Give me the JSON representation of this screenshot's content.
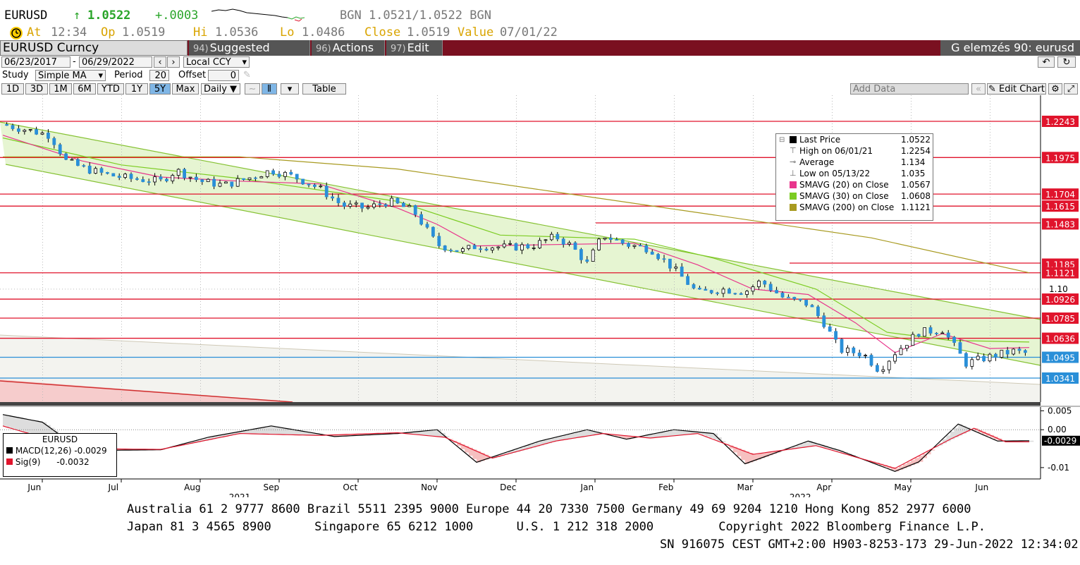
{
  "ticker": {
    "symbol": "EURUSD",
    "arrow": "↑",
    "last": "1.0522",
    "change": "+.0003",
    "bid_ask": "BGN 1.0521/1.0522 BGN",
    "at_label": "At",
    "at_value": "12:34",
    "op_label": "Op",
    "op_value": "1.0519",
    "hi_label": "Hi",
    "hi_value": "1.0536",
    "lo_label": "Lo",
    "lo_value": "1.0486",
    "close_label": "Close",
    "close_value": "1.0519",
    "value_label": "Value",
    "value_value": "07/01/22"
  },
  "toolbar": {
    "security": "EURUSD Curncy",
    "tabs": [
      {
        "num": "94)",
        "label": "Suggested Charts"
      },
      {
        "num": "96)",
        "label": "Actions ▾"
      },
      {
        "num": "97)",
        "label": "Edit ▾"
      }
    ],
    "right_title": "G elemzés 90: eurusd"
  },
  "controls": {
    "date_from": "06/23/2017",
    "date_to": "06/29/2022",
    "currency": "Local CCY",
    "study_label": "Study",
    "study_value": "Simple MA",
    "period_label": "Period",
    "period_value": "20",
    "offset_label": "Offset",
    "offset_value": "0",
    "ranges": [
      "1D",
      "3D",
      "1M",
      "6M",
      "YTD",
      "1Y",
      "5Y",
      "Max"
    ],
    "selected_range": "5Y",
    "frequency": "Daily ▼",
    "table_label": "Table",
    "add_data": "Add Data",
    "edit_chart": "Edit Chart"
  },
  "legend": {
    "rows": [
      {
        "label": "Last Price",
        "value": "1.0522",
        "color": "#000000"
      },
      {
        "label": "High on 06/01/21",
        "value": "1.2254",
        "color": ""
      },
      {
        "label": "Average",
        "value": "1.134",
        "color": ""
      },
      {
        "label": "Low on 05/13/22",
        "value": "1.035",
        "color": ""
      },
      {
        "label": "SMAVG (20)  on Close",
        "value": "1.0567",
        "color": "#e8358c"
      },
      {
        "label": "SMAVG (30)  on Close",
        "value": "1.0608",
        "color": "#7ccc22"
      },
      {
        "label": "SMAVG (200)  on Close",
        "value": "1.1121",
        "color": "#a89a20"
      }
    ]
  },
  "macd_legend": {
    "title": "EURUSD",
    "macd_label": "MACD(12,26)",
    "macd_value": "-0.0029",
    "sig_label": "Sig(9)",
    "sig_value": "-0.0032"
  },
  "chart_data": {
    "type": "candlestick",
    "price_axis": {
      "min": 1.03,
      "max": 1.245,
      "ticks": [
        "1.10"
      ]
    },
    "level_labels": [
      {
        "value": 1.2243,
        "label": "1.2243",
        "color": "#e0142c"
      },
      {
        "value": 1.1975,
        "label": "1.1975",
        "color": "#e0142c"
      },
      {
        "value": 1.1704,
        "label": "1.1704",
        "color": "#e0142c"
      },
      {
        "value": 1.1615,
        "label": "1.1615",
        "color": "#e0142c"
      },
      {
        "value": 1.1483,
        "label": "1.1483",
        "color": "#e0142c"
      },
      {
        "value": 1.1185,
        "label": "1.1185",
        "color": "#e0142c"
      },
      {
        "value": 1.1121,
        "label": "1.1121",
        "color": "#e0142c"
      },
      {
        "value": 1.0926,
        "label": "1.0926",
        "color": "#e0142c"
      },
      {
        "value": 1.0785,
        "label": "1.0785",
        "color": "#e0142c"
      },
      {
        "value": 1.0636,
        "label": "1.0636",
        "color": "#e0142c"
      },
      {
        "value": 1.0495,
        "label": "1.0495",
        "color": "#2a8fd8"
      },
      {
        "value": 1.0341,
        "label": "1.0341",
        "color": "#2a8fd8"
      }
    ],
    "months": [
      "Jun",
      "Jul",
      "Aug",
      "Sep",
      "Oct",
      "Nov",
      "Dec",
      "Jan",
      "Feb",
      "Mar",
      "Apr",
      "May",
      "Jun"
    ],
    "years": [
      "2021",
      "2022"
    ],
    "series": {
      "close": [
        {
          "m": 0.0,
          "v": 1.222
        },
        {
          "m": 0.3,
          "v": 1.218
        },
        {
          "m": 0.6,
          "v": 1.214
        },
        {
          "m": 0.8,
          "v": 1.195
        },
        {
          "m": 1.0,
          "v": 1.19
        },
        {
          "m": 1.3,
          "v": 1.185
        },
        {
          "m": 1.6,
          "v": 1.182
        },
        {
          "m": 2.0,
          "v": 1.18
        },
        {
          "m": 2.2,
          "v": 1.188
        },
        {
          "m": 2.5,
          "v": 1.18
        },
        {
          "m": 2.8,
          "v": 1.177
        },
        {
          "m": 3.1,
          "v": 1.182
        },
        {
          "m": 3.4,
          "v": 1.188
        },
        {
          "m": 3.7,
          "v": 1.183
        },
        {
          "m": 4.0,
          "v": 1.175
        },
        {
          "m": 4.3,
          "v": 1.162
        },
        {
          "m": 4.6,
          "v": 1.16
        },
        {
          "m": 4.9,
          "v": 1.165
        },
        {
          "m": 5.2,
          "v": 1.158
        },
        {
          "m": 5.5,
          "v": 1.133
        },
        {
          "m": 5.8,
          "v": 1.128
        },
        {
          "m": 6.0,
          "v": 1.132
        },
        {
          "m": 6.4,
          "v": 1.131
        },
        {
          "m": 6.7,
          "v": 1.132
        },
        {
          "m": 7.0,
          "v": 1.139
        },
        {
          "m": 7.2,
          "v": 1.132
        },
        {
          "m": 7.4,
          "v": 1.119
        },
        {
          "m": 7.6,
          "v": 1.14
        },
        {
          "m": 7.9,
          "v": 1.133
        },
        {
          "m": 8.2,
          "v": 1.13
        },
        {
          "m": 8.5,
          "v": 1.115
        },
        {
          "m": 8.8,
          "v": 1.097
        },
        {
          "m": 9.1,
          "v": 1.1
        },
        {
          "m": 9.4,
          "v": 1.098
        },
        {
          "m": 9.6,
          "v": 1.106
        },
        {
          "m": 9.9,
          "v": 1.093
        },
        {
          "m": 10.2,
          "v": 1.089
        },
        {
          "m": 10.4,
          "v": 1.075
        },
        {
          "m": 10.6,
          "v": 1.055
        },
        {
          "m": 10.9,
          "v": 1.052
        },
        {
          "m": 11.1,
          "v": 1.04
        },
        {
          "m": 11.3,
          "v": 1.053
        },
        {
          "m": 11.6,
          "v": 1.068
        },
        {
          "m": 11.9,
          "v": 1.07
        },
        {
          "m": 12.0,
          "v": 1.062
        },
        {
          "m": 12.2,
          "v": 1.045
        },
        {
          "m": 12.5,
          "v": 1.05
        },
        {
          "m": 12.8,
          "v": 1.054
        },
        {
          "m": 13.0,
          "v": 1.0522
        }
      ],
      "sma20": [
        {
          "m": 0.0,
          "v": 1.214
        },
        {
          "m": 1.0,
          "v": 1.195
        },
        {
          "m": 2.0,
          "v": 1.183
        },
        {
          "m": 3.0,
          "v": 1.18
        },
        {
          "m": 4.0,
          "v": 1.178
        },
        {
          "m": 5.0,
          "v": 1.16
        },
        {
          "m": 5.5,
          "v": 1.148
        },
        {
          "m": 6.0,
          "v": 1.132
        },
        {
          "m": 7.0,
          "v": 1.133
        },
        {
          "m": 8.0,
          "v": 1.134
        },
        {
          "m": 8.8,
          "v": 1.118
        },
        {
          "m": 9.5,
          "v": 1.1
        },
        {
          "m": 10.2,
          "v": 1.096
        },
        {
          "m": 10.8,
          "v": 1.075
        },
        {
          "m": 11.3,
          "v": 1.053
        },
        {
          "m": 11.9,
          "v": 1.067
        },
        {
          "m": 12.5,
          "v": 1.056
        },
        {
          "m": 13.0,
          "v": 1.0567
        }
      ],
      "sma30": [
        {
          "m": 0.0,
          "v": 1.212
        },
        {
          "m": 1.5,
          "v": 1.192
        },
        {
          "m": 3.0,
          "v": 1.182
        },
        {
          "m": 5.0,
          "v": 1.165
        },
        {
          "m": 6.3,
          "v": 1.14
        },
        {
          "m": 8.0,
          "v": 1.137
        },
        {
          "m": 9.0,
          "v": 1.123
        },
        {
          "m": 10.3,
          "v": 1.1
        },
        {
          "m": 11.2,
          "v": 1.068
        },
        {
          "m": 12.0,
          "v": 1.062
        },
        {
          "m": 13.0,
          "v": 1.0608
        }
      ],
      "sma200": [
        {
          "m": 0.0,
          "v": 1.198
        },
        {
          "m": 3.0,
          "v": 1.198
        },
        {
          "m": 5.0,
          "v": 1.189
        },
        {
          "m": 7.0,
          "v": 1.172
        },
        {
          "m": 9.0,
          "v": 1.155
        },
        {
          "m": 11.0,
          "v": 1.138
        },
        {
          "m": 13.0,
          "v": 1.1121
        }
      ]
    },
    "macd_axis": {
      "min": -0.013,
      "max": 0.006,
      "ticks": [
        "0.005",
        "0.00",
        "-0.01"
      ],
      "last_label": "-0.0029"
    },
    "macd": [
      {
        "m": 0.0,
        "v": 0.004
      },
      {
        "m": 0.5,
        "v": 0.002
      },
      {
        "m": 1.0,
        "v": -0.0055
      },
      {
        "m": 2.0,
        "v": -0.0053
      },
      {
        "m": 2.6,
        "v": -0.002
      },
      {
        "m": 3.4,
        "v": 0.001
      },
      {
        "m": 4.2,
        "v": -0.0018
      },
      {
        "m": 5.0,
        "v": -0.001
      },
      {
        "m": 5.5,
        "v": 0.0
      },
      {
        "m": 6.0,
        "v": -0.0086
      },
      {
        "m": 6.8,
        "v": -0.003
      },
      {
        "m": 7.4,
        "v": 0.0
      },
      {
        "m": 7.9,
        "v": -0.0025
      },
      {
        "m": 8.5,
        "v": 0.0
      },
      {
        "m": 9.0,
        "v": -0.001
      },
      {
        "m": 9.4,
        "v": -0.009
      },
      {
        "m": 10.2,
        "v": -0.003
      },
      {
        "m": 10.6,
        "v": -0.0055
      },
      {
        "m": 11.3,
        "v": -0.011
      },
      {
        "m": 11.6,
        "v": -0.0085
      },
      {
        "m": 12.1,
        "v": 0.0015
      },
      {
        "m": 12.6,
        "v": -0.003
      },
      {
        "m": 13.0,
        "v": -0.0029
      }
    ],
    "signal": [
      {
        "m": 0.0,
        "v": 0.001
      },
      {
        "m": 1.0,
        "v": -0.005
      },
      {
        "m": 2.0,
        "v": -0.0052
      },
      {
        "m": 3.0,
        "v": -0.001
      },
      {
        "m": 4.0,
        "v": -0.0015
      },
      {
        "m": 5.0,
        "v": -0.0008
      },
      {
        "m": 5.6,
        "v": -0.002
      },
      {
        "m": 6.2,
        "v": -0.0075
      },
      {
        "m": 7.0,
        "v": -0.003
      },
      {
        "m": 7.6,
        "v": -0.001
      },
      {
        "m": 8.2,
        "v": -0.0022
      },
      {
        "m": 8.8,
        "v": -0.001
      },
      {
        "m": 9.5,
        "v": -0.0065
      },
      {
        "m": 10.3,
        "v": -0.0042
      },
      {
        "m": 11.3,
        "v": -0.0102
      },
      {
        "m": 12.0,
        "v": -0.0025
      },
      {
        "m": 12.3,
        "v": 0.0004
      },
      {
        "m": 12.7,
        "v": -0.0032
      },
      {
        "m": 13.0,
        "v": -0.0032
      }
    ]
  },
  "footer": {
    "line1": "Australia 61 2 9777 8600 Brazil 5511 2395 9000 Europe 44 20 7330 7500 Germany 49 69 9204 1210 Hong Kong 852 2977 6000",
    "line2": "Japan 81 3 4565 8900      Singapore 65 6212 1000      U.S. 1 212 318 2000         Copyright 2022 Bloomberg Finance L.P.",
    "line3": "SN 916075 CEST GMT+2:00 H903-8253-173 29-Jun-2022 12:34:02"
  }
}
